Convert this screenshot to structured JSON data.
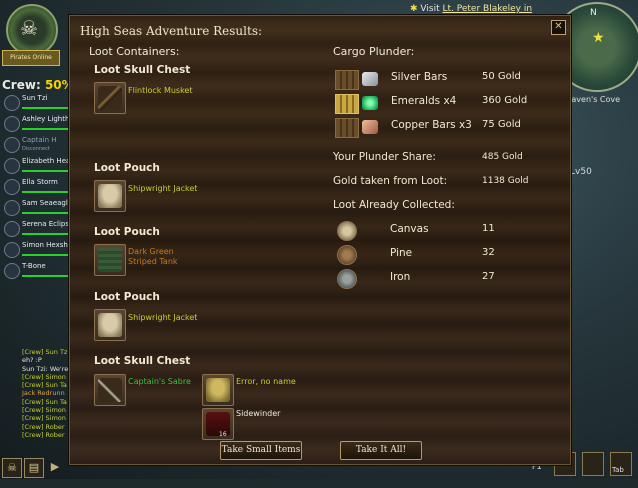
{
  "hud": {
    "emblem_banner": "Pirates Online",
    "crew_label": "Crew:",
    "crew_percent": "50%",
    "crew": [
      {
        "name": "Sun Tzi",
        "dim": false
      },
      {
        "name": "Ashley Lighthe",
        "dim": false
      },
      {
        "name": "Captain H",
        "dim": true
      },
      {
        "name": "Elizabeth Hea",
        "dim": false
      },
      {
        "name": "Ella Storm",
        "dim": false
      },
      {
        "name": "Sam Seaeagle",
        "dim": false
      },
      {
        "name": "Serena Eclipse",
        "dim": false
      },
      {
        "name": "Simon Hexsh",
        "dim": false
      },
      {
        "name": "T-Bone",
        "dim": false
      }
    ],
    "disconnected_label": "Disconnect",
    "chat_lines": [
      {
        "text": "[Crew] Sun Tz",
        "cls": "y"
      },
      {
        "text": "    eh? :P",
        "cls": "w"
      },
      {
        "text": "Sun Tzi: We're",
        "cls": "w"
      },
      {
        "text": "[Crew] Simon",
        "cls": "y"
      },
      {
        "text": "[Crew] Sun Ta",
        "cls": "y"
      },
      {
        "text": "Jack Redrunn",
        "cls": "o"
      },
      {
        "text": "[Crew] Sun Ta",
        "cls": "y"
      },
      {
        "text": "[Crew] Simon",
        "cls": "y"
      },
      {
        "text": "[Crew] Simon",
        "cls": "y"
      },
      {
        "text": "[Crew] Rober",
        "cls": "y"
      },
      {
        "text": "[Crew] Rober",
        "cls": "y"
      }
    ],
    "visit_prefix": "Visit",
    "visit_name": "Lt. Peter Blakeley in",
    "compass_n": "N",
    "location": "Raven's Cove",
    "level_text": "Lv50",
    "fkey_label": "F1",
    "tab_label": "Tab"
  },
  "window": {
    "title": "High Seas Adventure Results:",
    "close_glyph": "✕",
    "loot_containers_label": "Loot Containers:",
    "containers": [
      {
        "name": "Loot Skull Chest",
        "items": [
          {
            "name": "Flintlock Musket",
            "color": "yellow"
          }
        ]
      },
      {
        "name": "Loot Pouch",
        "items": [
          {
            "name": "Shipwright Jacket",
            "color": "yellow"
          }
        ]
      },
      {
        "name": "Loot Pouch",
        "items": [
          {
            "name": "Dark Green Striped Tank",
            "line1": "Dark Green",
            "line2": "Striped Tank",
            "color": "orange"
          }
        ]
      },
      {
        "name": "Loot Pouch",
        "items": [
          {
            "name": "Shipwright Jacket",
            "color": "yellow"
          }
        ]
      },
      {
        "name": "Loot Skull Chest",
        "items": [
          {
            "name": "Captain's Sabre",
            "color": "green"
          },
          {
            "name": "Error, no name",
            "color": "yellow"
          },
          {
            "name": "Sidewinder",
            "color": "white",
            "count": "16"
          }
        ]
      }
    ],
    "cargo_label": "Cargo Plunder:",
    "cargo": [
      {
        "name": "Silver Bars",
        "value": "50 Gold"
      },
      {
        "name": "Emeralds x4",
        "value": "360 Gold"
      },
      {
        "name": "Copper Bars x3",
        "value": "75 Gold"
      }
    ],
    "plunder_share_label": "Your Plunder Share:",
    "plunder_share_value": "485 Gold",
    "gold_from_loot_label": "Gold taken from Loot:",
    "gold_from_loot_value": "1138 Gold",
    "already_collected_label": "Loot Already Collected:",
    "collected": [
      {
        "name": "Canvas",
        "value": "11"
      },
      {
        "name": "Pine",
        "value": "32"
      },
      {
        "name": "Iron",
        "value": "27"
      }
    ],
    "take_small_label": "Take Small Items",
    "take_all_label": "Take It All!"
  },
  "colors": {
    "loot_yellow": "#c8d030",
    "loot_orange": "#c8781e",
    "crew_green": "#2bd02b",
    "crew_percent": "#f5d400"
  }
}
